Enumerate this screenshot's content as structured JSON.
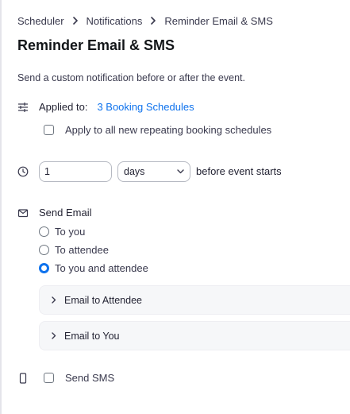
{
  "breadcrumb": {
    "items": [
      "Scheduler",
      "Notifications",
      "Reminder Email & SMS"
    ]
  },
  "page": {
    "title": "Reminder Email & SMS",
    "description": "Send a custom notification before or after the event."
  },
  "applied": {
    "label": "Applied to:",
    "link": "3 Booking Schedules",
    "apply_all_label": "Apply to all new repeating booking schedules",
    "apply_all_checked": false
  },
  "timing": {
    "amount_value": "1",
    "unit_selected": "days",
    "suffix": "before event starts"
  },
  "email": {
    "label": "Send Email",
    "options": [
      {
        "label": "To you",
        "selected": false
      },
      {
        "label": "To attendee",
        "selected": false
      },
      {
        "label": "To you and attendee",
        "selected": true
      }
    ],
    "sections": [
      "Email to Attendee",
      "Email to You"
    ]
  },
  "sms": {
    "label": "Send SMS",
    "checked": false
  },
  "icons": [
    "sliders-icon",
    "clock-icon",
    "envelope-icon",
    "phone-icon",
    "chevron-right-icon",
    "chevron-down-icon"
  ],
  "colors": {
    "accent": "#0e72ed",
    "text": "#232333",
    "border": "#b6b9c2",
    "panel_bg": "#f6f7f9"
  }
}
